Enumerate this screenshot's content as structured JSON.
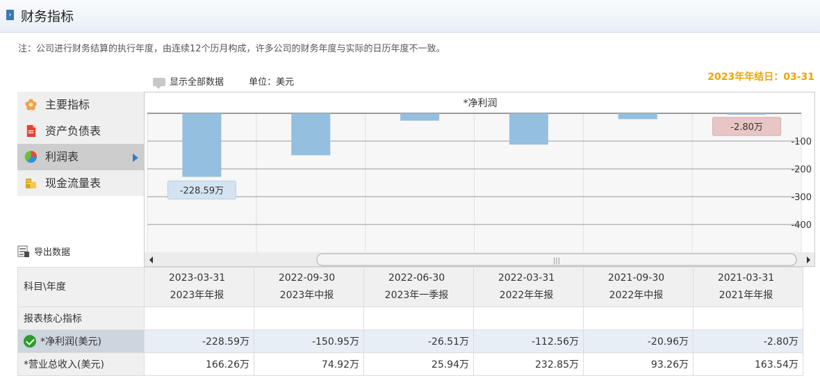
{
  "header": {
    "title": "财务指标"
  },
  "note": "注：公司进行财务结算的执行年度，由连续12个历月构成，许多公司的财务年度与实际的日历年度不一致。",
  "toolbar": {
    "show_all": "显示全部数据",
    "unit": "单位：美元"
  },
  "year_end": "2023年年结日：03-31",
  "sidebar": {
    "items": [
      {
        "label": "主要指标",
        "icon": "flower-icon"
      },
      {
        "label": "资产负债表",
        "icon": "document-icon"
      },
      {
        "label": "利润表",
        "icon": "pie-chart-icon",
        "active": true
      },
      {
        "label": "现金流量表",
        "icon": "coins-icon"
      }
    ]
  },
  "export": {
    "label": "导出数据"
  },
  "chart_data": {
    "type": "bar",
    "title": "*净利润",
    "categories": [
      "2023-03-31",
      "2022-09-30",
      "2022-06-30",
      "2022-03-31",
      "2021-09-30",
      "2021-03-31"
    ],
    "series": [
      {
        "values": [
          -228.59,
          -150.95,
          -26.51,
          -112.56,
          -20.96,
          -2.8
        ]
      }
    ],
    "data_labels": [
      {
        "index": 0,
        "text": "-228.59万"
      },
      {
        "index": 5,
        "text": "-2.80万"
      }
    ],
    "yticks": [
      -100,
      -200,
      -300,
      -400
    ],
    "ylim": [
      -500,
      0
    ],
    "grid": true,
    "bar_color": "#94bfdf"
  },
  "table": {
    "corner": "科目\\年度",
    "columns": [
      {
        "date": "2023-03-31",
        "report": "2023年年报"
      },
      {
        "date": "2022-09-30",
        "report": "2023年中报"
      },
      {
        "date": "2022-06-30",
        "report": "2023年一季报"
      },
      {
        "date": "2022-03-31",
        "report": "2022年年报"
      },
      {
        "date": "2021-09-30",
        "report": "2022年中报"
      },
      {
        "date": "2021-03-31",
        "report": "2021年年报"
      }
    ],
    "section": "报表核心指标",
    "rows": [
      {
        "label": "*净利润(美元)",
        "values": [
          "-228.59万",
          "-150.95万",
          "-26.51万",
          "-112.56万",
          "-20.96万",
          "-2.80万"
        ]
      },
      {
        "label": "*营业总收入(美元)",
        "values": [
          "166.26万",
          "74.92万",
          "25.94万",
          "232.85万",
          "93.26万",
          "163.54万"
        ]
      }
    ]
  }
}
